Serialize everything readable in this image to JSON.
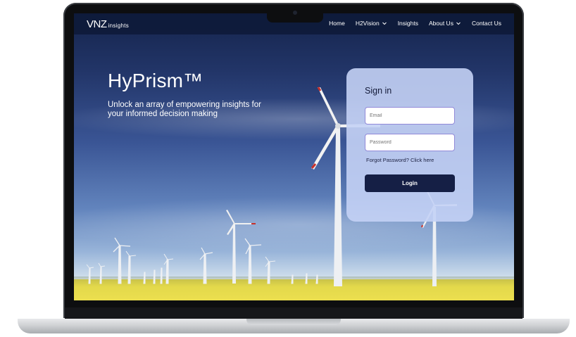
{
  "brand": {
    "logo_main": "VNZ",
    "logo_sub": "insights"
  },
  "nav": {
    "items": [
      {
        "label": "Home",
        "has_dropdown": false
      },
      {
        "label": "H2Vision",
        "has_dropdown": true
      },
      {
        "label": "Insights",
        "has_dropdown": false
      },
      {
        "label": "About Us",
        "has_dropdown": true
      },
      {
        "label": "Contact Us",
        "has_dropdown": false
      }
    ]
  },
  "hero": {
    "title": "HyPrism™",
    "subtitle": "Unlock an array of empowering insights for your informed decision making"
  },
  "signin": {
    "title": "Sign in",
    "email_placeholder": "Email",
    "password_placeholder": "Password",
    "forgot_text": "Forgot Password?",
    "forgot_link": "Click here",
    "login_label": "Login"
  },
  "colors": {
    "navbar": "#0e1a3a",
    "card": "#c4d2f5",
    "login_button": "#151f45",
    "input_border": "#9088d8"
  },
  "icons": {
    "dropdown": "chevron-down-icon"
  }
}
